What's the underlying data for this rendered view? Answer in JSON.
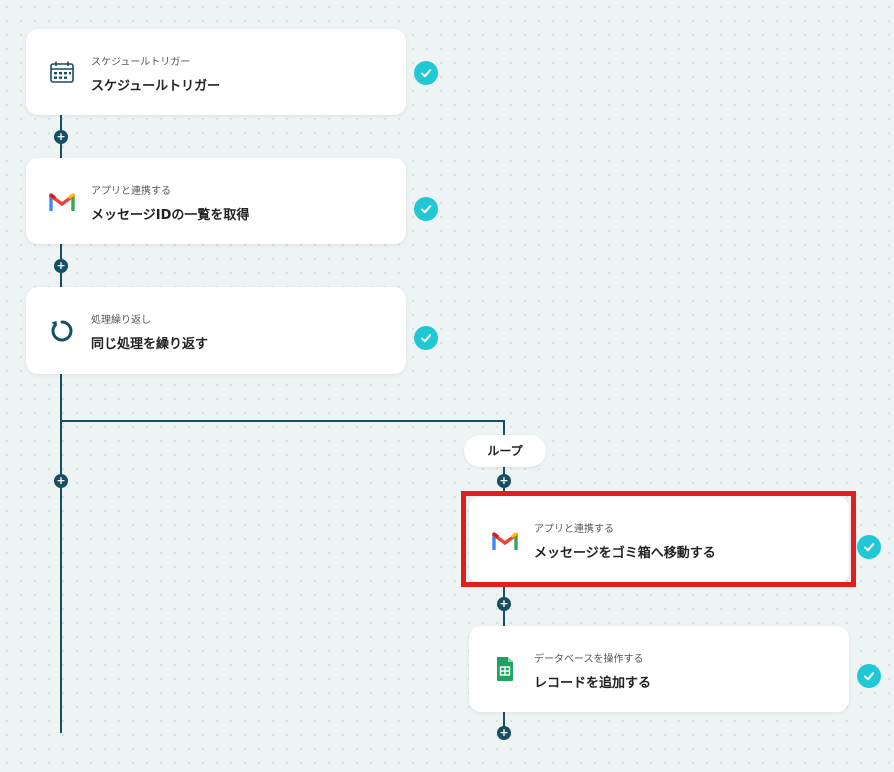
{
  "steps": [
    {
      "sub": "スケジュールトリガー",
      "title": "スケジュールトリガー",
      "icon": "calendar-icon"
    },
    {
      "sub": "アプリと連携する",
      "title": "メッセージIDの一覧を取得",
      "icon": "gmail-icon"
    },
    {
      "sub": "処理繰り返し",
      "title": "同じ処理を繰り返す",
      "icon": "loop-icon"
    }
  ],
  "loop": {
    "label": "ループ",
    "steps": [
      {
        "sub": "アプリと連携する",
        "title": "メッセージをゴミ箱へ移動する",
        "icon": "gmail-icon"
      },
      {
        "sub": "データベースを操作する",
        "title": "レコードを追加する",
        "icon": "google-sheets-icon"
      }
    ]
  },
  "colors": {
    "connector": "#164e63",
    "check": "#22c7d6",
    "highlight": "#e11d1d",
    "sheets": "#1ea362"
  }
}
